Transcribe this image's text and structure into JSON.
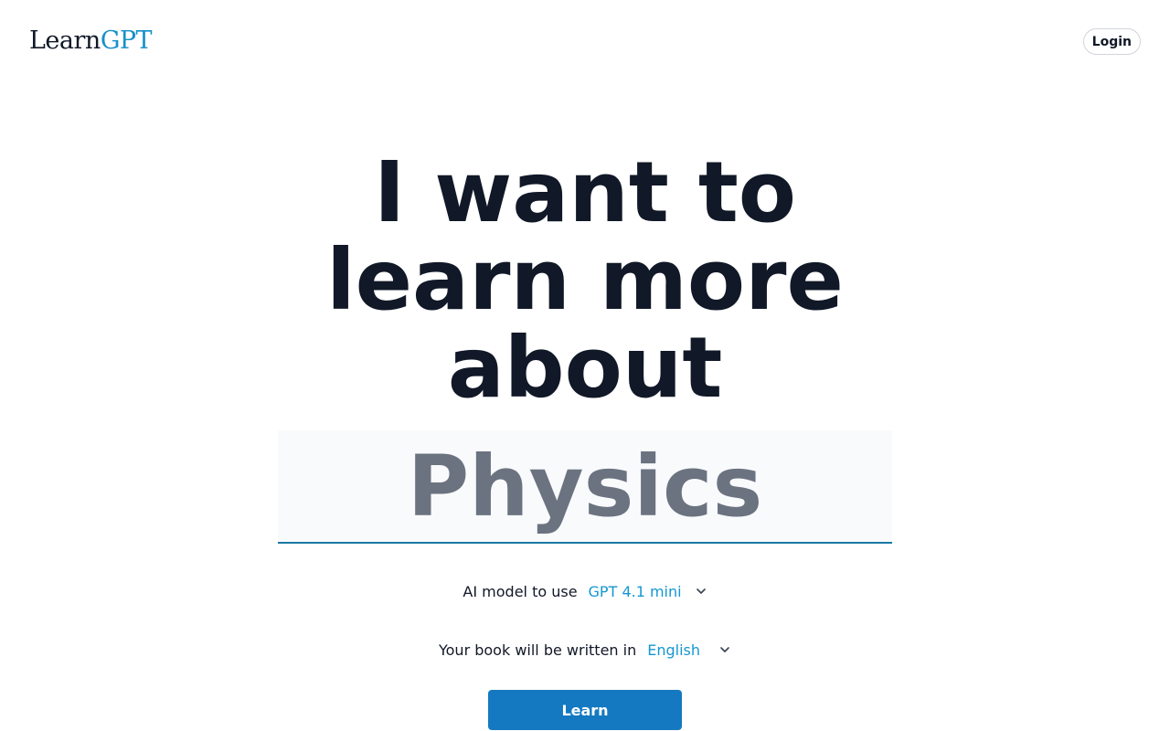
{
  "header": {
    "logo_learn": "Learn",
    "logo_gpt": "GPT",
    "login_label": "Login"
  },
  "hero": {
    "line1": "I want to",
    "line2": "learn more",
    "line3": "about"
  },
  "topic": {
    "placeholder": "Physics",
    "value": ""
  },
  "model_select": {
    "label": "AI model to use",
    "selected": "GPT 4.1 mini",
    "icon": "chevron-down-icon"
  },
  "language_select": {
    "label": "Your book will be written in",
    "selected": "English",
    "icon": "chevron-down-icon"
  },
  "actions": {
    "learn_label": "Learn"
  },
  "colors": {
    "accent": "#1479c0",
    "logo_accent": "#1590c9",
    "select_text": "#1597d1",
    "headline": "#111827",
    "topic_text": "#6b7280",
    "topic_bg": "#f8fafc",
    "topic_underline": "#1a7aa3"
  }
}
